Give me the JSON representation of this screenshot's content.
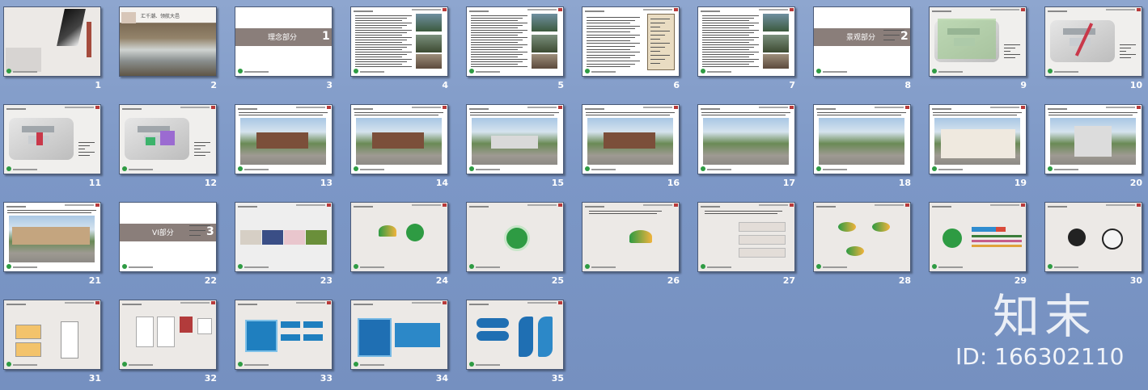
{
  "slide_sorter": {
    "slides": [
      {
        "number": "1",
        "kind": "cover"
      },
      {
        "number": "2",
        "kind": "photo-title",
        "title": "汇千潮、领航大邑"
      },
      {
        "number": "3",
        "kind": "section",
        "label": "理念部分",
        "section_num": "1"
      },
      {
        "number": "4",
        "kind": "text-photos"
      },
      {
        "number": "5",
        "kind": "text-photos"
      },
      {
        "number": "6",
        "kind": "text-calligraphy"
      },
      {
        "number": "7",
        "kind": "text-photos"
      },
      {
        "number": "8",
        "kind": "section",
        "label": "景观部分",
        "section_num": "2"
      },
      {
        "number": "9",
        "kind": "plan"
      },
      {
        "number": "10",
        "kind": "plan"
      },
      {
        "number": "11",
        "kind": "plan"
      },
      {
        "number": "12",
        "kind": "plan"
      },
      {
        "number": "13",
        "kind": "render"
      },
      {
        "number": "14",
        "kind": "render"
      },
      {
        "number": "15",
        "kind": "render"
      },
      {
        "number": "16",
        "kind": "render"
      },
      {
        "number": "17",
        "kind": "render"
      },
      {
        "number": "18",
        "kind": "render"
      },
      {
        "number": "19",
        "kind": "render"
      },
      {
        "number": "20",
        "kind": "render"
      },
      {
        "number": "21",
        "kind": "render"
      },
      {
        "number": "22",
        "kind": "section",
        "label": "VI部分",
        "section_num": "3"
      },
      {
        "number": "23",
        "kind": "vi-images"
      },
      {
        "number": "24",
        "kind": "vi-logo"
      },
      {
        "number": "25",
        "kind": "vi-logo"
      },
      {
        "number": "26",
        "kind": "vi-logo"
      },
      {
        "number": "27",
        "kind": "vi-text"
      },
      {
        "number": "28",
        "kind": "vi-logo"
      },
      {
        "number": "29",
        "kind": "vi-colors"
      },
      {
        "number": "30",
        "kind": "vi-mono"
      },
      {
        "number": "31",
        "kind": "vi-cards"
      },
      {
        "number": "32",
        "kind": "vi-stationery"
      },
      {
        "number": "33",
        "kind": "vi-signs"
      },
      {
        "number": "34",
        "kind": "vi-signs"
      },
      {
        "number": "35",
        "kind": "vi-signs"
      }
    ]
  },
  "watermark": {
    "brand": "知末",
    "id_text": "ID: 166302110"
  },
  "colors": {
    "background": "#7f99c8",
    "section_band": "#8a7e7a",
    "logo_green": "#2e9b43",
    "thumb_border": "#4a5a78"
  }
}
